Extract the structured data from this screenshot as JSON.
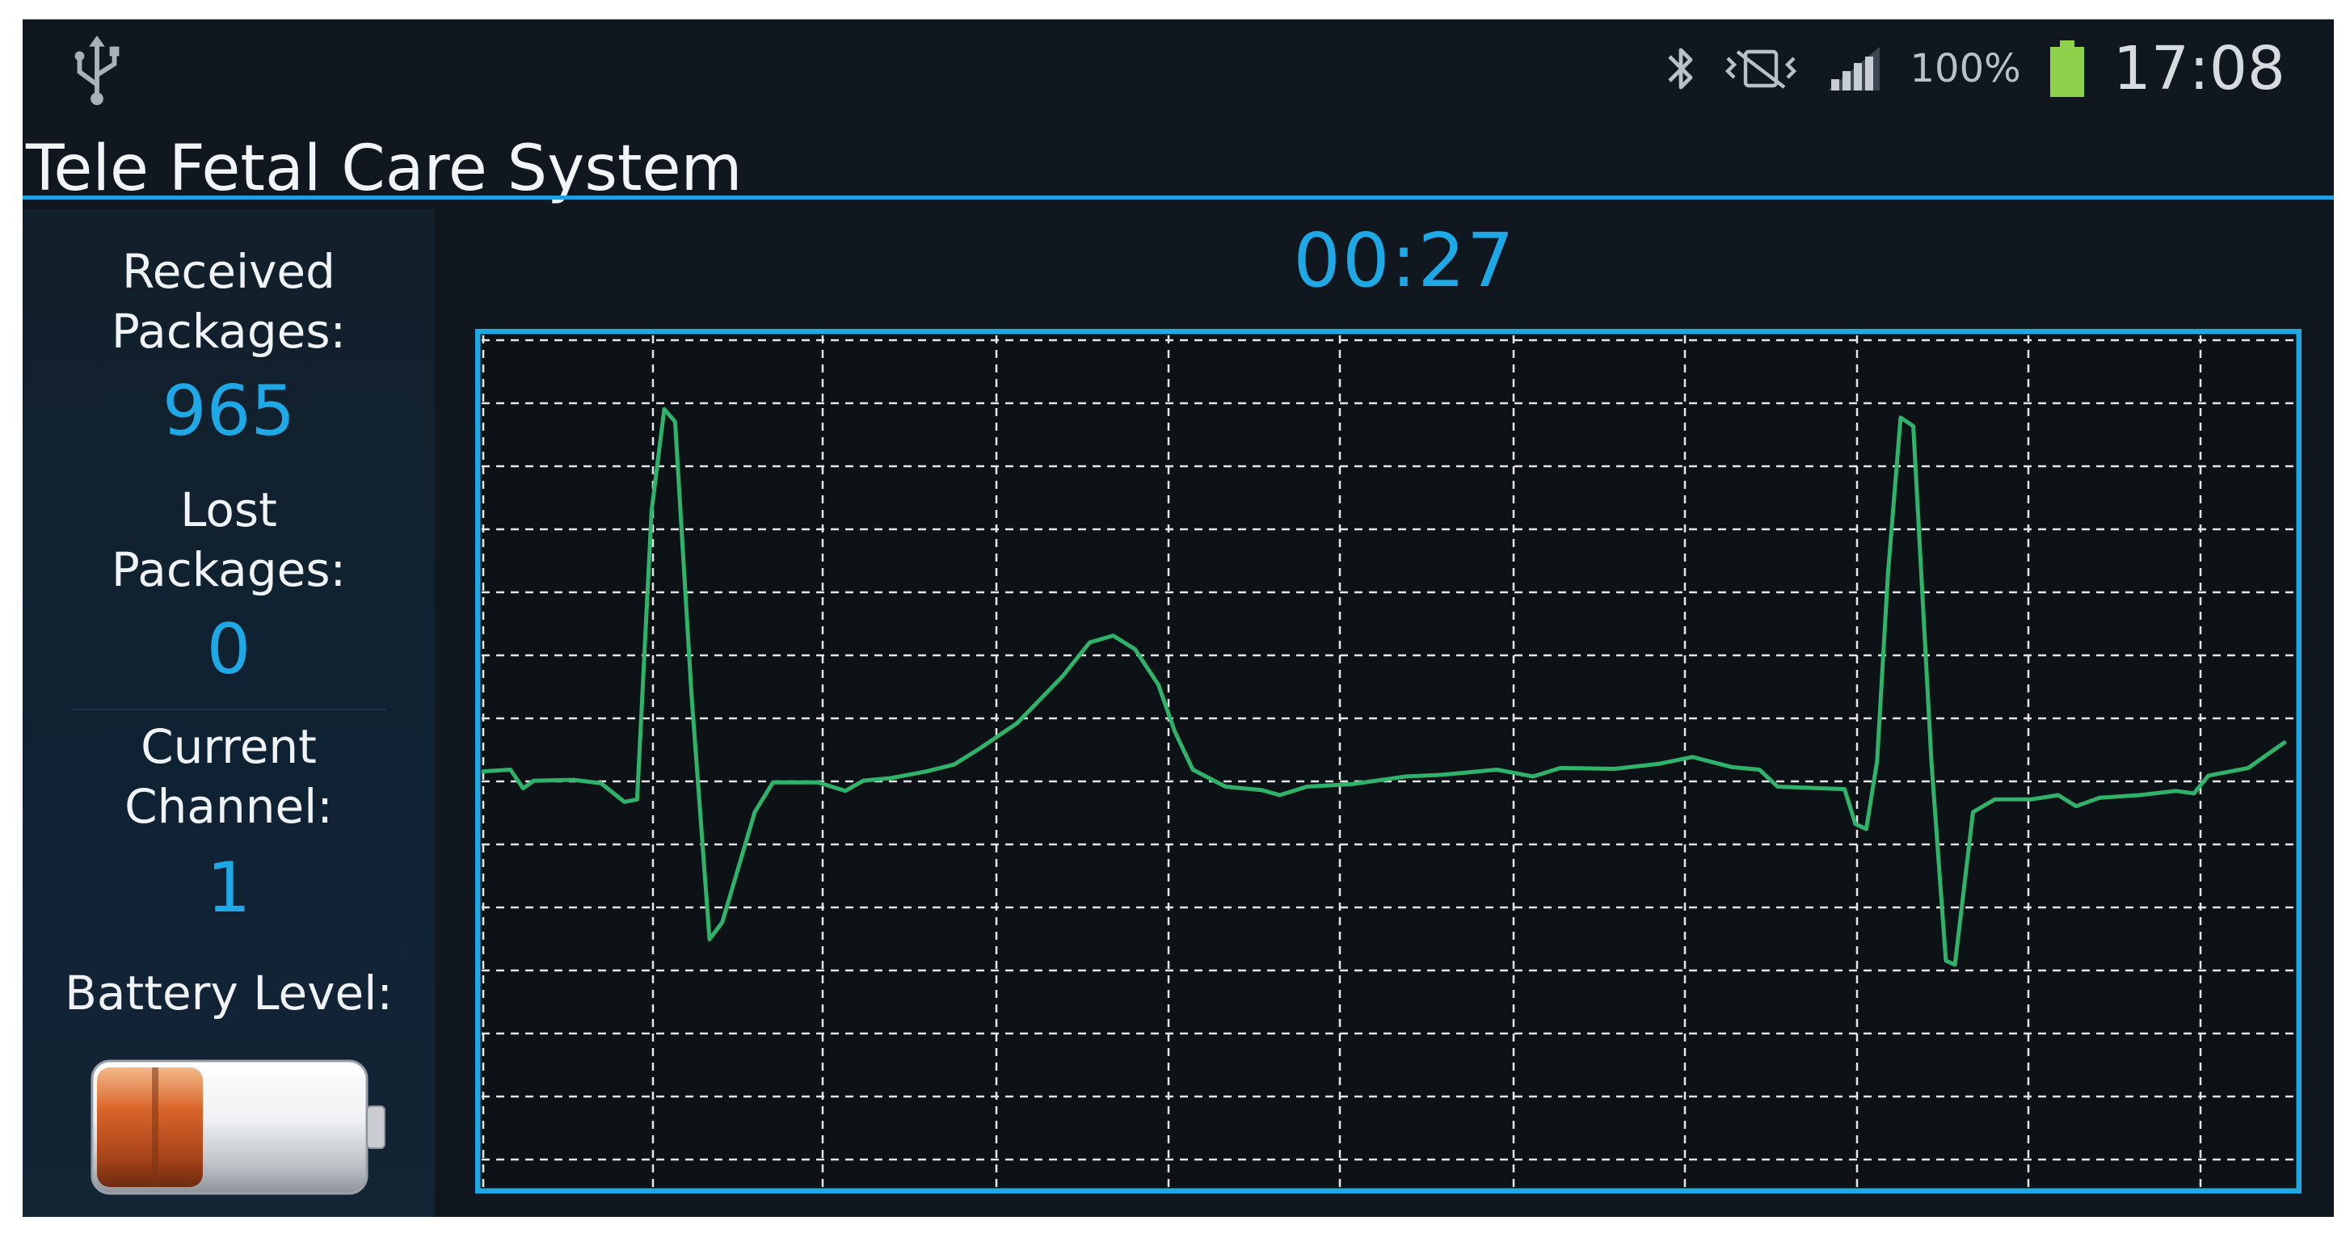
{
  "status_bar": {
    "icons": [
      "usb-icon",
      "bluetooth-icon",
      "vibrate-icon",
      "signal-icon",
      "battery-full-icon"
    ],
    "battery_percent": "100%",
    "time": "17:08",
    "battery_color": "#8ed14a"
  },
  "app": {
    "title": "Tele Fetal Care System"
  },
  "stats": {
    "received_label": "Received\nPackages:",
    "received_value": "965",
    "lost_label": "Lost\nPackages:",
    "lost_value": "0",
    "channel_label": "Current\nChannel:",
    "channel_value": "1",
    "battery_label": "Battery Level:",
    "battery_level": 0.4,
    "battery_icon": "battery-level-icon"
  },
  "timer": {
    "value": "00:27"
  },
  "colors": {
    "accent": "#1ea8e6",
    "trace": "#2fb36a",
    "grid": "#e6e6e6",
    "screen_bg": "#10171f"
  },
  "chart_data": {
    "type": "line",
    "title": "",
    "xlabel": "",
    "ylabel": "",
    "grid": true,
    "xlim": [
      0,
      1
    ],
    "ylim": [
      0,
      1
    ],
    "series": [
      {
        "values": [
          [
            0.0,
            0.512
          ],
          [
            0.015,
            0.51
          ],
          [
            0.022,
            0.532
          ],
          [
            0.028,
            0.523
          ],
          [
            0.05,
            0.522
          ],
          [
            0.065,
            0.526
          ],
          [
            0.078,
            0.548
          ],
          [
            0.085,
            0.545
          ],
          [
            0.093,
            0.205
          ],
          [
            0.1,
            0.085
          ],
          [
            0.106,
            0.1
          ],
          [
            0.115,
            0.42
          ],
          [
            0.125,
            0.71
          ],
          [
            0.132,
            0.69
          ],
          [
            0.15,
            0.56
          ],
          [
            0.16,
            0.525
          ],
          [
            0.185,
            0.525
          ],
          [
            0.2,
            0.535
          ],
          [
            0.21,
            0.523
          ],
          [
            0.225,
            0.52
          ],
          [
            0.245,
            0.512
          ],
          [
            0.26,
            0.504
          ],
          [
            0.275,
            0.484
          ],
          [
            0.295,
            0.455
          ],
          [
            0.32,
            0.4
          ],
          [
            0.335,
            0.36
          ],
          [
            0.348,
            0.352
          ],
          [
            0.36,
            0.368
          ],
          [
            0.373,
            0.41
          ],
          [
            0.382,
            0.465
          ],
          [
            0.392,
            0.51
          ],
          [
            0.41,
            0.53
          ],
          [
            0.43,
            0.534
          ],
          [
            0.44,
            0.54
          ],
          [
            0.455,
            0.53
          ],
          [
            0.48,
            0.527
          ],
          [
            0.51,
            0.518
          ],
          [
            0.53,
            0.516
          ],
          [
            0.56,
            0.51
          ],
          [
            0.58,
            0.518
          ],
          [
            0.595,
            0.508
          ],
          [
            0.625,
            0.509
          ],
          [
            0.65,
            0.503
          ],
          [
            0.668,
            0.495
          ],
          [
            0.69,
            0.507
          ],
          [
            0.705,
            0.51
          ],
          [
            0.715,
            0.53
          ],
          [
            0.74,
            0.532
          ],
          [
            0.752,
            0.533
          ],
          [
            0.758,
            0.574
          ],
          [
            0.764,
            0.58
          ],
          [
            0.77,
            0.5
          ],
          [
            0.776,
            0.28
          ],
          [
            0.783,
            0.095
          ],
          [
            0.79,
            0.105
          ],
          [
            0.8,
            0.5
          ],
          [
            0.808,
            0.735
          ],
          [
            0.813,
            0.74
          ],
          [
            0.823,
            0.56
          ],
          [
            0.835,
            0.545
          ],
          [
            0.855,
            0.545
          ],
          [
            0.87,
            0.54
          ],
          [
            0.88,
            0.553
          ],
          [
            0.893,
            0.543
          ],
          [
            0.915,
            0.54
          ],
          [
            0.935,
            0.535
          ],
          [
            0.945,
            0.538
          ],
          [
            0.953,
            0.517
          ],
          [
            0.975,
            0.508
          ],
          [
            0.995,
            0.478
          ]
        ]
      }
    ]
  }
}
